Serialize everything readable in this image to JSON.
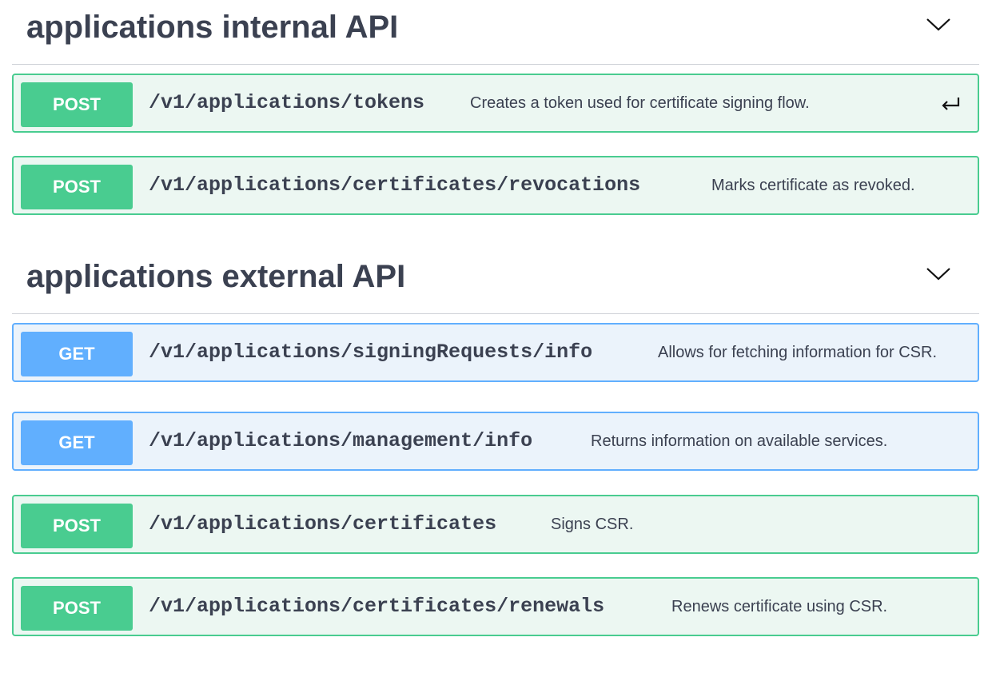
{
  "sections": [
    {
      "title": "applications internal API",
      "operations": [
        {
          "method": "POST",
          "path": "/v1/applications/tokens",
          "summary": "Creates a token used for certificate signing flow."
        },
        {
          "method": "POST",
          "path": "/v1/applications/certificates/revocations",
          "summary": "Marks certificate as revoked."
        }
      ]
    },
    {
      "title": "applications external API",
      "operations": [
        {
          "method": "GET",
          "path": "/v1/applications/signingRequests/info",
          "summary": "Allows for fetching information for CSR."
        },
        {
          "method": "GET",
          "path": "/v1/applications/management/info",
          "summary": "Returns information on available services."
        },
        {
          "method": "POST",
          "path": "/v1/applications/certificates",
          "summary": "Signs CSR."
        },
        {
          "method": "POST",
          "path": "/v1/applications/certificates/renewals",
          "summary": "Renews certificate using CSR."
        }
      ]
    }
  ],
  "icons": {
    "section_toggle": "chevron-down-icon",
    "focused_operation": "return-arrow-icon"
  },
  "colors": {
    "post": "#49cc90",
    "get": "#61affe",
    "text": "#3b4151"
  }
}
